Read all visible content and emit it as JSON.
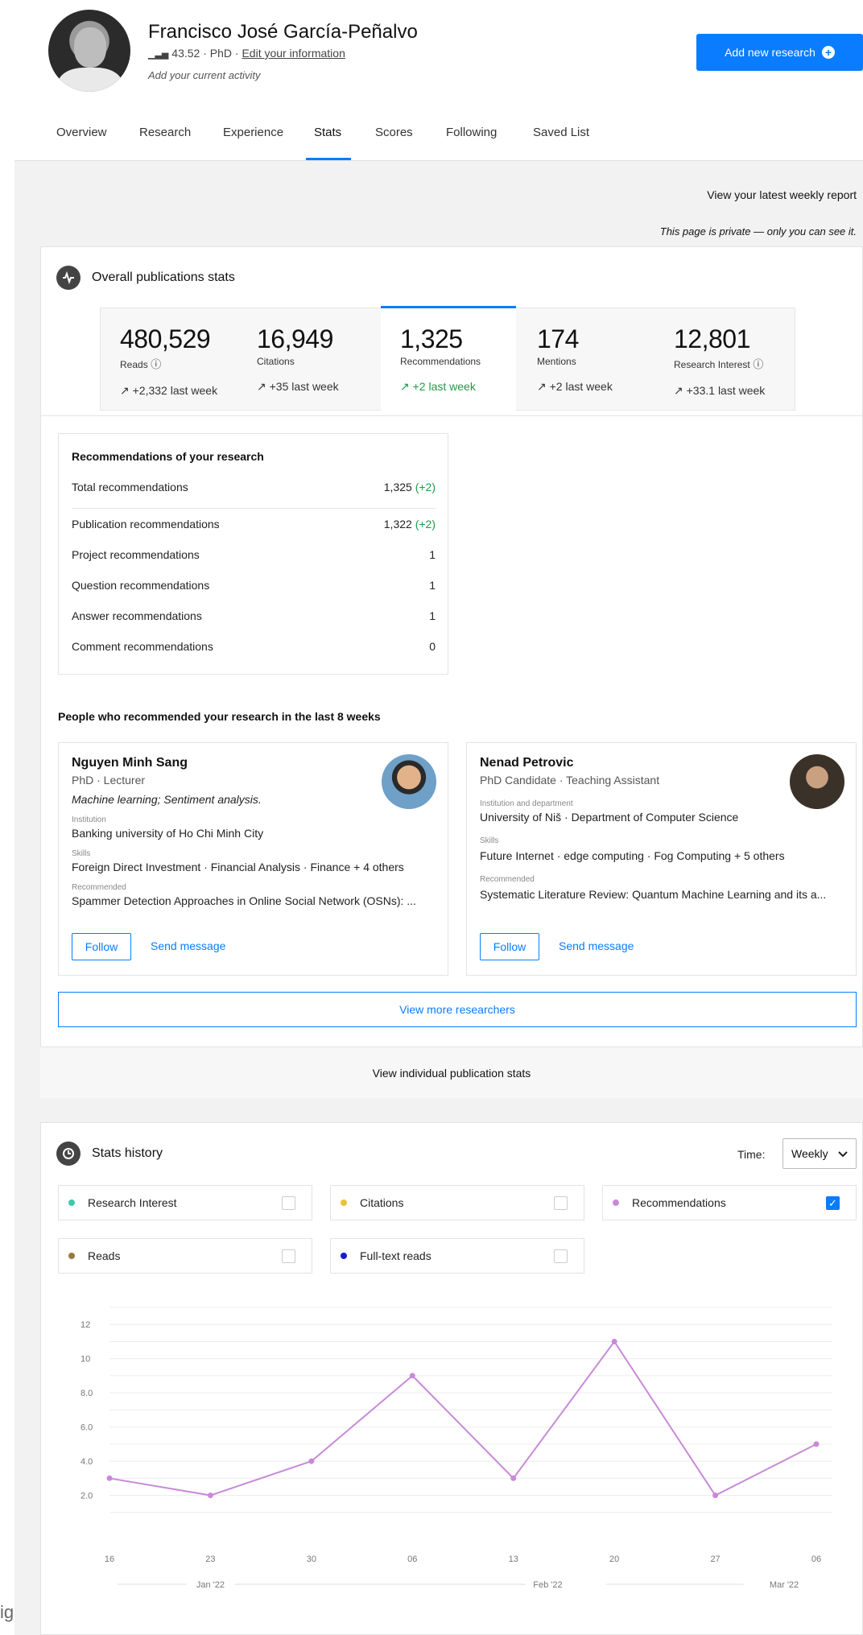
{
  "profile": {
    "name": "Francisco José García-Peñalvo",
    "score": "43.52",
    "degree": "PhD",
    "edit_link": "Edit your information",
    "activity_placeholder": "Add your current activity",
    "add_research_label": "Add new research"
  },
  "tabs": [
    {
      "label": "Overview"
    },
    {
      "label": "Research"
    },
    {
      "label": "Experience"
    },
    {
      "label": "Stats",
      "active": true
    },
    {
      "label": "Scores"
    },
    {
      "label": "Following"
    },
    {
      "label": "Saved List"
    }
  ],
  "weekly_report_link": "View your latest weekly report",
  "privacy_note": "This page is private — only you can see it.",
  "overall": {
    "title": "Overall publications stats",
    "stats": [
      {
        "value": "480,529",
        "label": "Reads",
        "delta": "+2,332 last week",
        "info": true
      },
      {
        "value": "16,949",
        "label": "Citations",
        "delta": "+35 last week"
      },
      {
        "value": "1,325",
        "label": "Recommendations",
        "delta": "+2 last week",
        "active": true
      },
      {
        "value": "174",
        "label": "Mentions",
        "delta": "+2 last week"
      },
      {
        "value": "12,801",
        "label": "Research Interest",
        "delta": "+33.1 last week",
        "info": true
      }
    ]
  },
  "recommendations": {
    "title": "Recommendations of your research",
    "total": {
      "label": "Total recommendations",
      "value": "1,325",
      "delta": "(+2)"
    },
    "rows": [
      {
        "label": "Publication recommendations",
        "value": "1,322",
        "delta": "(+2)"
      },
      {
        "label": "Project recommendations",
        "value": "1"
      },
      {
        "label": "Question recommendations",
        "value": "1"
      },
      {
        "label": "Answer recommendations",
        "value": "1"
      },
      {
        "label": "Comment recommendations",
        "value": "0"
      }
    ]
  },
  "people": {
    "title": "People who recommended your research in the last 8 weeks",
    "list": [
      {
        "name": "Nguyen Minh Sang",
        "role": "PhD · Lecturer",
        "interests": "Machine learning; Sentiment analysis.",
        "inst_label": "Institution",
        "institution": "Banking university of Ho Chi Minh City",
        "skills_label": "Skills",
        "skills": "Foreign Direct Investment · Financial Analysis · Finance + 4 others",
        "rec_label": "Recommended",
        "recommended": "Spammer Detection Approaches in Online Social Network (OSNs): ...",
        "follow": "Follow",
        "message": "Send message"
      },
      {
        "name": "Nenad Petrovic",
        "role": "PhD Candidate · Teaching Assistant",
        "inst_label": "Institution and department",
        "institution": "University of Niš · Department of Computer Science",
        "skills_label": "Skills",
        "skills": "Future Internet · edge computing · Fog Computing + 5 others",
        "rec_label": "Recommended",
        "recommended": "Systematic Literature Review: Quantum Machine Learning and its a...",
        "follow": "Follow",
        "message": "Send message"
      }
    ],
    "view_more": "View more researchers"
  },
  "view_individual": "View individual publication stats",
  "history": {
    "title": "Stats history",
    "time_label": "Time:",
    "time_value": "Weekly",
    "legend": [
      {
        "label": "Research Interest",
        "color": "#3fc9a8",
        "checked": false
      },
      {
        "label": "Citations",
        "color": "#e8c33a",
        "checked": false
      },
      {
        "label": "Recommendations",
        "color": "#c88ad8",
        "checked": true
      },
      {
        "label": "Reads",
        "color": "#9a7a3a",
        "checked": false
      },
      {
        "label": "Full-text reads",
        "color": "#1a1acc",
        "checked": false
      }
    ]
  },
  "chart_data": {
    "type": "line",
    "x": [
      "16",
      "23",
      "30",
      "06",
      "13",
      "20",
      "27",
      "06"
    ],
    "months": [
      "Jan '22",
      "Feb '22",
      "Mar '22"
    ],
    "y_ticks": [
      "2.0",
      "4.0",
      "6.0",
      "8.0",
      "10",
      "12"
    ],
    "ylim": [
      0,
      13
    ],
    "series": [
      {
        "name": "Recommendations",
        "color": "#c88ad8",
        "values": [
          3,
          2,
          4,
          9,
          3,
          11,
          2,
          5
        ]
      }
    ]
  },
  "left_edge_text": "ig"
}
